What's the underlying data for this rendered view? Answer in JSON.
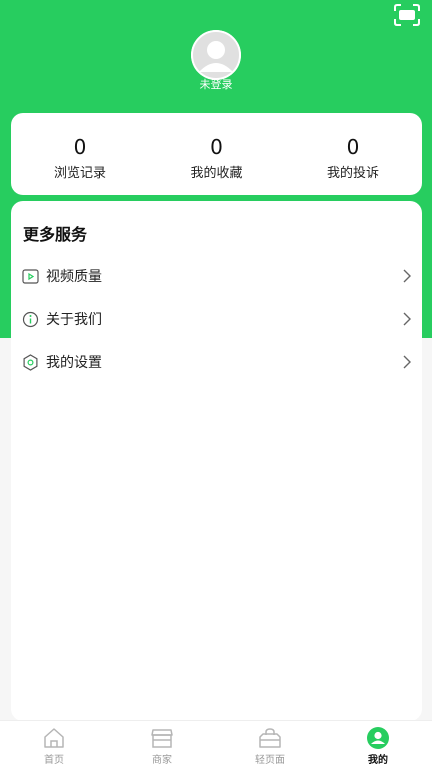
{
  "header": {
    "login_status": "未登录"
  },
  "stats": [
    {
      "value": "0",
      "label": "浏览记录"
    },
    {
      "value": "0",
      "label": "我的收藏"
    },
    {
      "value": "0",
      "label": "我的投诉"
    }
  ],
  "services": {
    "title": "更多服务",
    "items": [
      {
        "label": "视频质量",
        "icon": "video-icon"
      },
      {
        "label": "关于我们",
        "icon": "info-icon"
      },
      {
        "label": "我的设置",
        "icon": "settings-icon"
      }
    ]
  },
  "bottom_nav": [
    {
      "label": "首页",
      "icon": "home-icon",
      "active": false
    },
    {
      "label": "商家",
      "icon": "store-icon",
      "active": false
    },
    {
      "label": "轻页面",
      "icon": "bag-icon",
      "active": false
    },
    {
      "label": "我的",
      "icon": "profile-icon",
      "active": true
    }
  ],
  "colors": {
    "brand": "#27cd5f",
    "card": "#ffffff",
    "background": "#f6f6f6"
  }
}
